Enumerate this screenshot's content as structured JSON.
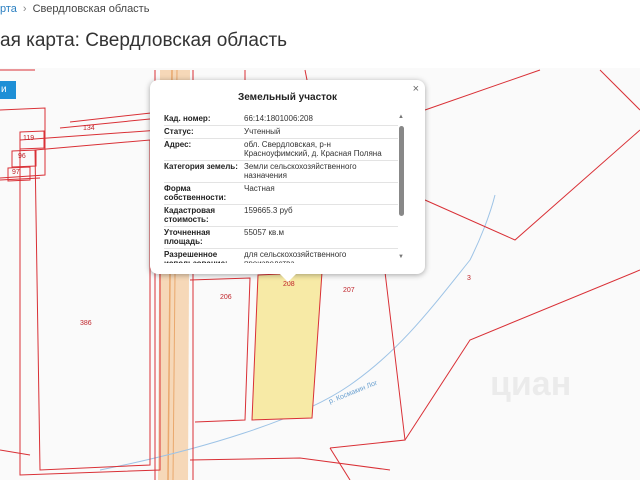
{
  "breadcrumb": {
    "link": "рта",
    "current": "Свердловская область"
  },
  "page": {
    "title": "ая карта: Свердловская область"
  },
  "map": {
    "button_label": "и",
    "plot_numbers": [
      "119",
      "96",
      "97",
      "134",
      "386",
      "206",
      "208",
      "207",
      "3"
    ],
    "stream_label": "р. Космакин Лог",
    "watermark": "циан"
  },
  "popup": {
    "title": "Земельный участок",
    "close": "×",
    "rows": [
      {
        "label": "Кад. номер:",
        "value": "66:14:1801006:208"
      },
      {
        "label": "Статус:",
        "value": "Учтенный"
      },
      {
        "label": "Адрес:",
        "value": "обл. Свердловская, р-н Красноуфимский, д. Красная Поляна"
      },
      {
        "label": "Категория земель:",
        "value": "Земли сельскохозяйственного назначения"
      },
      {
        "label": "Форма собственности:",
        "value": "Частная"
      },
      {
        "label": "Кадастровая стоимость:",
        "value": "159665.3 руб"
      },
      {
        "label": "Уточненная площадь:",
        "value": "55057 кв.м"
      },
      {
        "label": "Разрешенное использование:",
        "value": "для сельскохозяйственного производства"
      }
    ]
  },
  "colors": {
    "boundary": "#d93036",
    "selected_fill": "#f7eaa6",
    "road": "#f3c59a",
    "stream": "#9dc3e6",
    "accent": "#1e8fd6"
  }
}
